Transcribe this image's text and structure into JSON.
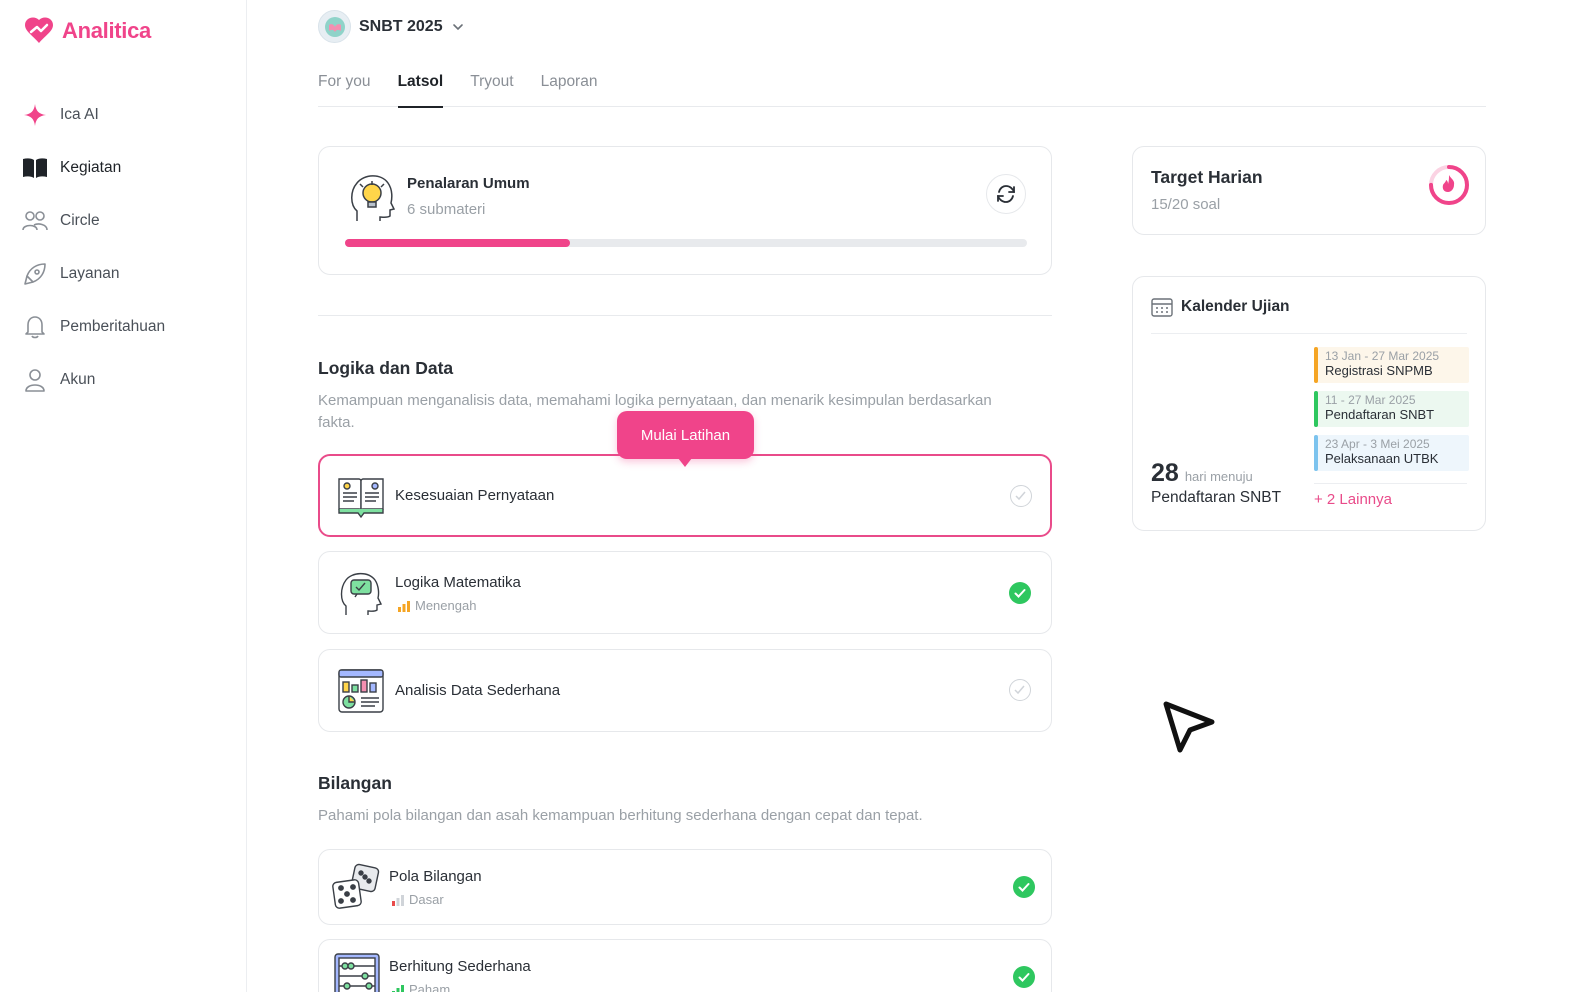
{
  "app": {
    "brand": "Analitica",
    "brand_color": "#f0448a"
  },
  "sidebar": {
    "items": [
      {
        "label": "Ica AI",
        "icon": "sparkle-icon"
      },
      {
        "label": "Kegiatan",
        "icon": "book-icon",
        "active": true
      },
      {
        "label": "Circle",
        "icon": "users-icon"
      },
      {
        "label": "Layanan",
        "icon": "rocket-icon"
      },
      {
        "label": "Pemberitahuan",
        "icon": "bell-icon"
      },
      {
        "label": "Akun",
        "icon": "user-icon"
      }
    ]
  },
  "header": {
    "exam": "SNBT 2025",
    "tabs": [
      "For you",
      "Latsol",
      "Tryout",
      "Laporan"
    ],
    "active_tab": "Latsol"
  },
  "subject": {
    "title": "Penalaran Umum",
    "subtitle": "6 submateri",
    "progress": 0.33
  },
  "tooltip": {
    "label": "Mulai Latihan"
  },
  "sections": [
    {
      "title": "Logika dan Data",
      "description": "Kemampuan menganalisis data, memahami logika pernyataan, dan menarik kesimpulan berdasarkan fakta.",
      "lessons": [
        {
          "title": "Kesesuaian Pernyataan",
          "level": "",
          "done": false,
          "selected": true
        },
        {
          "title": "Logika Matematika",
          "level": "Menengah",
          "done": true
        },
        {
          "title": "Analisis Data Sederhana",
          "level": "",
          "done": false
        }
      ]
    },
    {
      "title": "Bilangan",
      "description": "Pahami pola bilangan dan asah kemampuan berhitung sederhana dengan cepat dan tepat.",
      "lessons": [
        {
          "title": "Pola Bilangan",
          "level": "Dasar",
          "done": true
        },
        {
          "title": "Berhitung Sederhana",
          "level": "Paham",
          "done": true
        }
      ]
    }
  ],
  "target": {
    "title": "Target Harian",
    "progress_text": "15/20 soal",
    "progress": 0.75
  },
  "calendar": {
    "title": "Kalender Ujian",
    "days": "28",
    "days_unit": "hari menuju",
    "target_event": "Pendaftaran SNBT",
    "events": [
      {
        "date": "13 Jan - 27 Mar 2025",
        "name": "Registrasi SNPMB",
        "color": "#f5a524",
        "bg": "#fdf6ea"
      },
      {
        "date": "11 - 27 Mar 2025",
        "name": "Pendaftaran SNBT",
        "color": "#2ec75f",
        "bg": "#ecf8f0"
      },
      {
        "date": "23 Apr - 3 Mei 2025",
        "name": "Pelaksanaan UTBK",
        "color": "#7cc3ee",
        "bg": "#eef6fc"
      }
    ],
    "more": "+ 2 Lainnya"
  }
}
